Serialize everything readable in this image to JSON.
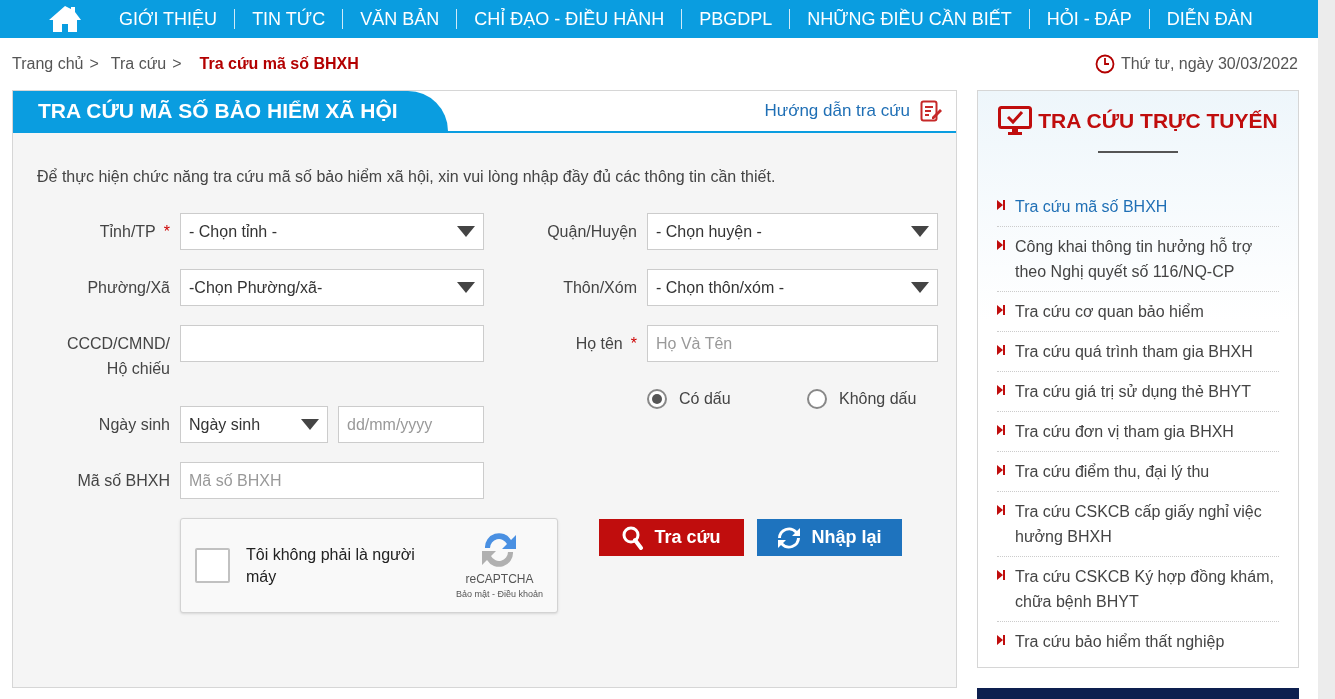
{
  "nav": {
    "items": [
      "GIỚI THIỆU",
      "TIN TỨC",
      "VĂN BẢN",
      "CHỈ ĐẠO - ĐIỀU HÀNH",
      "PBGDPL",
      "NHỮNG ĐIỀU CẦN BIẾT",
      "HỎI - ĐÁP",
      "DIỄN ĐÀN"
    ]
  },
  "breadcrumb": {
    "items": [
      {
        "label": "Trang chủ",
        "current": false
      },
      {
        "label": "Tra cứu",
        "current": false
      },
      {
        "label": "Tra cứu mã số BHXH",
        "current": true
      }
    ],
    "separator": ">",
    "date": "Thứ tư, ngày 30/03/2022"
  },
  "panel": {
    "title": "TRA CỨU MÃ SỐ BẢO HIỂM XÃ HỘI",
    "guide_link": "Hướng dẫn tra cứu",
    "intro": "Để thực hiện chức năng tra cứu mã số bảo hiểm xã hội, xin vui lòng nhập đầy đủ các thông tin cần thiết.",
    "left_fields": [
      {
        "kind": "select",
        "label": "Tỉnh/TP",
        "required": true,
        "value": "- Chọn tỉnh -"
      },
      {
        "kind": "select",
        "label": "Phường/Xã",
        "required": false,
        "value": "-Chọn Phường/xã-"
      },
      {
        "kind": "text",
        "label": "CCCD/CMND/ Hộ chiếu",
        "required": false
      },
      {
        "kind": "date",
        "label": "Ngày sinh",
        "required": false,
        "value": "Ngày sinh",
        "placeholder": "dd/mm/yyyy"
      },
      {
        "kind": "text",
        "label": "Mã số BHXH",
        "required": false,
        "placeholder": "Mã số BHXH"
      }
    ],
    "right_fields": [
      {
        "kind": "select",
        "label": "Quận/Huyện",
        "required": false,
        "value": "- Chọn huyện -"
      },
      {
        "kind": "select",
        "label": "Thôn/Xóm",
        "required": false,
        "value": "- Chọn thôn/xóm -"
      },
      {
        "kind": "text",
        "label": "Họ tên",
        "required": true,
        "placeholder": "Họ Và Tên"
      }
    ],
    "required_mark": "*",
    "name_options": [
      {
        "label": "Có dấu",
        "selected": true
      },
      {
        "label": "Không dấu",
        "selected": false
      }
    ],
    "captcha": {
      "checked": false,
      "label": "Tôi không phải là người máy",
      "brand": "reCAPTCHA",
      "links": "Bảo mật - Điều khoản"
    },
    "buttons": [
      {
        "kind": "search",
        "label": "Tra cứu"
      },
      {
        "kind": "reset",
        "label": "Nhập lại"
      }
    ]
  },
  "sidebar": {
    "title": "TRA CỨU TRỰC TUYẾN",
    "items": [
      {
        "label": "Tra cứu mã số BHXH",
        "selected": true
      },
      {
        "label": "Công khai thông tin hưởng hỗ trợ theo Nghị quyết số 116/NQ-CP",
        "selected": false
      },
      {
        "label": "Tra cứu cơ quan bảo hiểm",
        "selected": false
      },
      {
        "label": "Tra cứu quá trình tham gia BHXH",
        "selected": false
      },
      {
        "label": "Tra cứu giá trị sử dụng thẻ BHYT",
        "selected": false
      },
      {
        "label": "Tra cứu đơn vị tham gia BHXH",
        "selected": false
      },
      {
        "label": "Tra cứu điểm thu, đại lý thu",
        "selected": false
      },
      {
        "label": "Tra cứu CSKCB cấp giấy nghỉ việc hưởng BHXH",
        "selected": false
      },
      {
        "label": "Tra cứu CSKCB Ký hợp đồng khám, chữa bệnh BHYT",
        "selected": false
      },
      {
        "label": "Tra cứu bảo hiểm thất nghiệp",
        "selected": false
      }
    ]
  }
}
